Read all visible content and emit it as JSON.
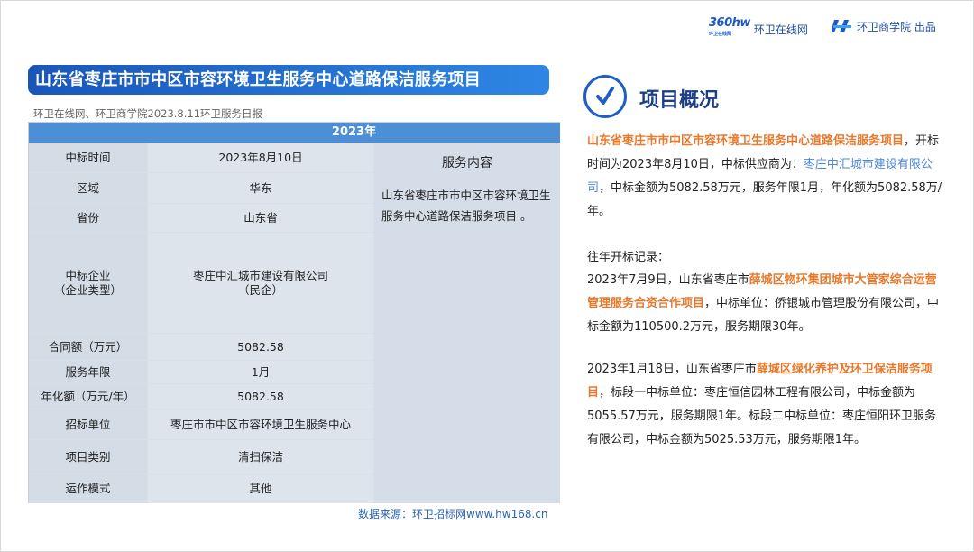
{
  "header": {
    "brand1_logo_text": "360hw",
    "brand1_logo_small": "环卫在线网",
    "brand1_name": "环卫在线网",
    "brand2_name": "环卫商学院 出品"
  },
  "title": "山东省枣庄市市中区市容环境卫生服务中心道路保洁服务项目",
  "subnote": "环卫在线网、环卫商学院2023.8.11环卫服务日报",
  "table": {
    "year_header": "2023年",
    "rows": [
      {
        "label": "中标时间",
        "value": "2023年8月10日"
      },
      {
        "label": "区域",
        "value": "华东"
      },
      {
        "label": "省份",
        "value": "山东省"
      },
      {
        "label": "中标企业\n（企业类型）",
        "value": "枣庄中汇城市建设有限公司\n（民企）"
      },
      {
        "label": "合同额（万元）",
        "value": "5082.58"
      },
      {
        "label": "服务年限",
        "value": "1月"
      },
      {
        "label": "年化额（万元/年）",
        "value": "5082.58"
      },
      {
        "label": "招标单位",
        "value": "枣庄市市中区市容环境卫生服务中心"
      },
      {
        "label": "项目类别",
        "value": "清扫保洁"
      },
      {
        "label": "运作模式",
        "value": "其他"
      }
    ],
    "service_title": "服务内容",
    "service_body": "山东省枣庄市市中区市容环境卫生服务中心道路保洁服务项目 。"
  },
  "source": "数据来源：环卫招标网www.hw168.cn",
  "overview": {
    "title": "项目概况",
    "p1_project": "山东省枣庄市市中区市容环境卫生服务中心道路保洁服务项目",
    "p1_text1": "，开标时间为2023年8月10日，中标供应商为：",
    "p1_supplier": "枣庄中汇城市建设有限公司",
    "p1_text2": "，中标金额为5082.58万元，服务年限1月，年化额为5082.58万/年。",
    "history_title": "往年开标记录：",
    "h1_prefix": "2023年7月9日，山东省枣庄市",
    "h1_project": "薛城区物环集团城市大管家综合运营管理服务合资合作项目",
    "h1_suffix": "，中标单位：侨银城市管理股份有限公司，中标金额为110500.2万元，服务期限30年。",
    "h2_prefix": "2023年1月18日，山东省枣庄市",
    "h2_project": "薛城区绿化养护及环卫保洁服务项目",
    "h2_suffix": "，标段一中标单位：枣庄恒信园林工程有限公司，中标金额为5055.57万元，服务期限1年。标段二中标单位：枣庄恒阳环卫服务有限公司，中标金额为5025.53万元，服务期限1年。"
  },
  "colors": {
    "title_bar_start": "#1a56b8",
    "title_bar_end": "#2f86e4",
    "table_header": "#4d8fd6",
    "highlight_orange": "#e8792c",
    "highlight_blue": "#4a86d8"
  }
}
